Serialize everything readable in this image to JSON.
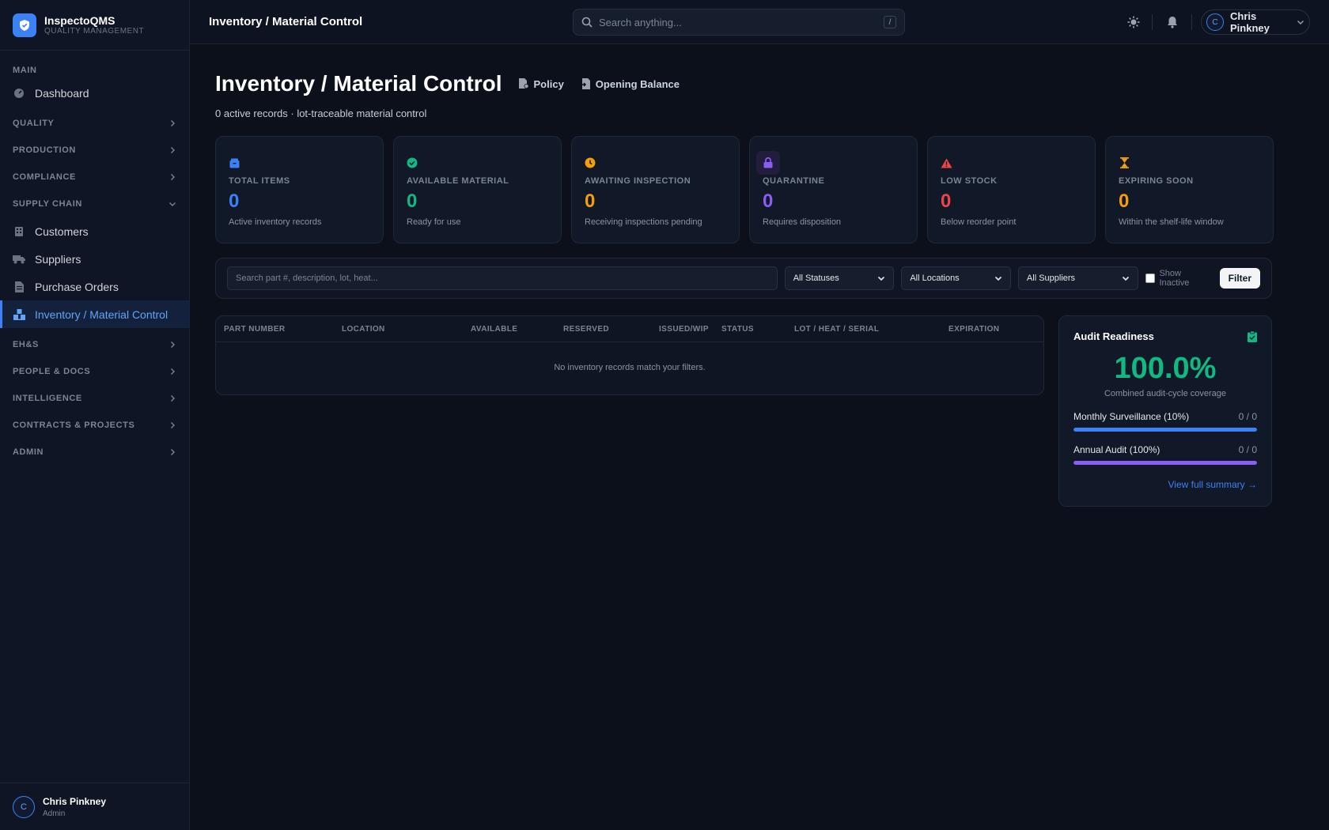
{
  "brand": {
    "name": "InspectoQMS",
    "subtitle": "QUALITY MANAGEMENT"
  },
  "sidebar": {
    "main_label": "MAIN",
    "dashboard": "Dashboard",
    "sections": {
      "quality": "QUALITY",
      "production": "PRODUCTION",
      "compliance": "COMPLIANCE",
      "supply_chain": "SUPPLY CHAIN",
      "ehs": "EH&S",
      "people_docs": "PEOPLE & DOCS",
      "intelligence": "INTELLIGENCE",
      "contracts": "CONTRACTS & PROJECTS",
      "admin": "ADMIN"
    },
    "supply_items": [
      "Customers",
      "Suppliers",
      "Purchase Orders",
      "Inventory / Material Control"
    ],
    "user": {
      "initial": "C",
      "name": "Chris Pinkney",
      "role": "Admin"
    }
  },
  "topbar": {
    "title": "Inventory / Material Control",
    "search_placeholder": "Search anything...",
    "search_shortcut": "/",
    "user_initial": "C",
    "user_name": "Chris Pinkney"
  },
  "page": {
    "title": "Inventory / Material Control",
    "policy_label": "Policy",
    "opening_balance_label": "Opening Balance",
    "subtitle": "0 active records · lot-traceable material control"
  },
  "stats": [
    {
      "label": "TOTAL ITEMS",
      "value": "0",
      "desc": "Active inventory records",
      "color": "#3b82f6",
      "icon": "box-icon"
    },
    {
      "label": "AVAILABLE MATERIAL",
      "value": "0",
      "desc": "Ready for use",
      "color": "#10b981",
      "icon": "check-circle-icon"
    },
    {
      "label": "AWAITING INSPECTION",
      "value": "0",
      "desc": "Receiving inspections pending",
      "color": "#f59e0b",
      "icon": "clock-icon"
    },
    {
      "label": "QUARANTINE",
      "value": "0",
      "desc": "Requires disposition",
      "color": "#8b5cf6",
      "icon": "lock-icon"
    },
    {
      "label": "LOW STOCK",
      "value": "0",
      "desc": "Below reorder point",
      "color": "#ef4444",
      "icon": "warning-icon"
    },
    {
      "label": "EXPIRING SOON",
      "value": "0",
      "desc": "Within the shelf-life window",
      "color": "#f59e0b",
      "icon": "hourglass-icon"
    }
  ],
  "filters": {
    "search_placeholder": "Search part #, description, lot, heat...",
    "status": "All Statuses",
    "location": "All Locations",
    "supplier": "All Suppliers",
    "show_inactive": "Show Inactive",
    "button": "Filter"
  },
  "table": {
    "columns": [
      "PART NUMBER",
      "LOCATION",
      "AVAILABLE",
      "RESERVED",
      "ISSUED/WIP",
      "STATUS",
      "LOT / HEAT / SERIAL",
      "EXPIRATION"
    ],
    "empty": "No inventory records match your filters."
  },
  "audit": {
    "title": "Audit Readiness",
    "percent": "100.0%",
    "subtitle": "Combined audit-cycle coverage",
    "rows": [
      {
        "label": "Monthly Surveillance (10%)",
        "count": "0 / 0",
        "color": "#3b82f6",
        "fill": 1.0
      },
      {
        "label": "Annual Audit (100%)",
        "count": "0 / 0",
        "color": "#8b5cf6",
        "fill": 1.0
      }
    ],
    "link": "View full summary →"
  }
}
